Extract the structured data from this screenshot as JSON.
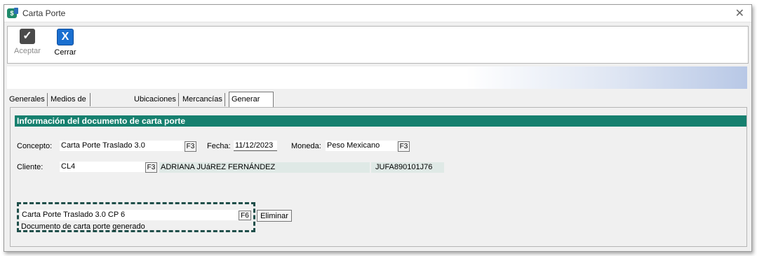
{
  "window": {
    "title": "Carta Porte",
    "close_glyph": "✕",
    "app_icon_letter": "$"
  },
  "toolbar": {
    "aceptar": {
      "label": "Aceptar",
      "enabled": false
    },
    "cerrar": {
      "label": "Cerrar",
      "enabled": true
    }
  },
  "tabs": [
    {
      "label": "Generales",
      "active": false
    },
    {
      "label": "Medios de Transporte",
      "active": false
    },
    {
      "label": "Ubicaciones",
      "active": false
    },
    {
      "label": "Mercancías",
      "active": false
    },
    {
      "label": "Generar Documento",
      "active": true
    }
  ],
  "section": {
    "header": "Información del documento de carta porte"
  },
  "form": {
    "concepto_label": "Concepto:",
    "concepto_value": "Carta Porte Traslado 3.0",
    "fecha_label": "Fecha:",
    "fecha_value": "11/12/2023",
    "moneda_label": "Moneda:",
    "moneda_value": "Peso Mexicano",
    "cliente_label": "Cliente:",
    "cliente_value": "CL4",
    "cliente_name": "ADRIANA JUáREZ FERNÁNDEZ",
    "cliente_rfc": "JUFA890101J76",
    "f3_label": "F3"
  },
  "documento": {
    "value": "Carta Porte Traslado 3.0 CP 6",
    "f6_label": "F6",
    "eliminar_label": "Eliminar",
    "status": "Documento de carta porte generado"
  },
  "colors": {
    "section_header": "#16806f",
    "cerrar_icon": "#1a6fd0",
    "highlight_dash": "#1f4f4a"
  }
}
